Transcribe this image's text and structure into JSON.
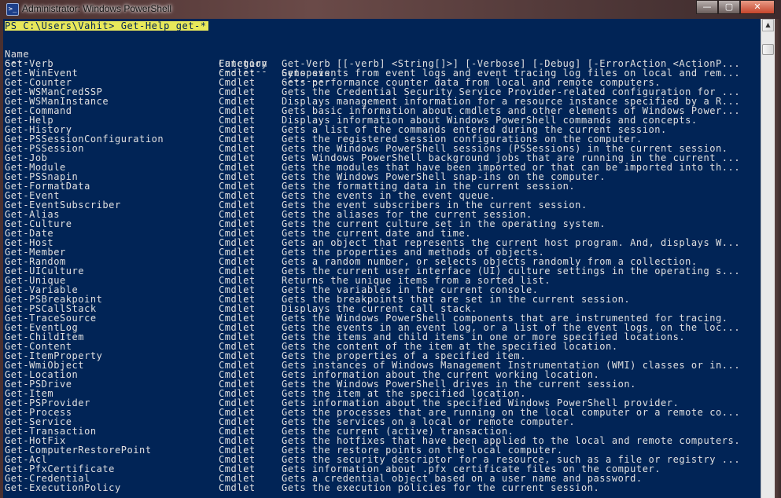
{
  "window": {
    "title": "Administrator: Windows PowerShell",
    "icon_label": ">_",
    "controls": {
      "minimize": "—",
      "maximize": "▢",
      "close": "✕"
    }
  },
  "console": {
    "prompt": "PS C:\\Users\\Vahit> Get-Help get-*",
    "headers": [
      "Name",
      "Category",
      "Synopsis"
    ],
    "underlines": [
      "----",
      "--------",
      "--------"
    ],
    "rows": [
      [
        "Get-Verb",
        "Function",
        "Get-Verb [[-verb] <String[]>] [-Verbose] [-Debug] [-ErrorAction <ActionP..."
      ],
      [
        "Get-WinEvent",
        "Cmdlet",
        "Gets events from event logs and event tracing log files on local and rem..."
      ],
      [
        "Get-Counter",
        "Cmdlet",
        "Gets performance counter data from local and remote computers."
      ],
      [
        "Get-WSManCredSSP",
        "Cmdlet",
        "Gets the Credential Security Service Provider-related configuration for ..."
      ],
      [
        "Get-WSManInstance",
        "Cmdlet",
        "Displays management information for a resource instance specified by a R..."
      ],
      [
        "Get-Command",
        "Cmdlet",
        "Gets basic information about cmdlets and other elements of Windows Power..."
      ],
      [
        "Get-Help",
        "Cmdlet",
        "Displays information about Windows PowerShell commands and concepts."
      ],
      [
        "Get-History",
        "Cmdlet",
        "Gets a list of the commands entered during the current session."
      ],
      [
        "Get-PSSessionConfiguration",
        "Cmdlet",
        "Gets the registered session configurations on the computer."
      ],
      [
        "Get-PSSession",
        "Cmdlet",
        "Gets the Windows PowerShell sessions (PSSessions) in the current session."
      ],
      [
        "Get-Job",
        "Cmdlet",
        "Gets Windows PowerShell background jobs that are running in the current ..."
      ],
      [
        "Get-Module",
        "Cmdlet",
        "Gets the modules that have been imported or that can be imported into th..."
      ],
      [
        "Get-PSSnapin",
        "Cmdlet",
        "Gets the Windows PowerShell snap-ins on the computer."
      ],
      [
        "Get-FormatData",
        "Cmdlet",
        "Gets the formatting data in the current session."
      ],
      [
        "Get-Event",
        "Cmdlet",
        "Gets the events in the event queue."
      ],
      [
        "Get-EventSubscriber",
        "Cmdlet",
        "Gets the event subscribers in the current session."
      ],
      [
        "Get-Alias",
        "Cmdlet",
        "Gets the aliases for the current session."
      ],
      [
        "Get-Culture",
        "Cmdlet",
        "Gets the current culture set in the operating system."
      ],
      [
        "Get-Date",
        "Cmdlet",
        "Gets the current date and time."
      ],
      [
        "Get-Host",
        "Cmdlet",
        "Gets an object that represents the current host program. And, displays W..."
      ],
      [
        "Get-Member",
        "Cmdlet",
        "Gets the properties and methods of objects."
      ],
      [
        "Get-Random",
        "Cmdlet",
        "Gets a random number, or selects objects randomly from a collection."
      ],
      [
        "Get-UICulture",
        "Cmdlet",
        "Gets the current user interface (UI) culture settings in the operating s..."
      ],
      [
        "Get-Unique",
        "Cmdlet",
        "Returns the unique items from a sorted list."
      ],
      [
        "Get-Variable",
        "Cmdlet",
        "Gets the variables in the current console."
      ],
      [
        "Get-PSBreakpoint",
        "Cmdlet",
        "Gets the breakpoints that are set in the current session."
      ],
      [
        "Get-PSCallStack",
        "Cmdlet",
        "Displays the current call stack."
      ],
      [
        "Get-TraceSource",
        "Cmdlet",
        "Gets the Windows PowerShell components that are instrumented for tracing."
      ],
      [
        "Get-EventLog",
        "Cmdlet",
        "Gets the events in an event log, or a list of the event logs, on the loc..."
      ],
      [
        "Get-ChildItem",
        "Cmdlet",
        "Gets the items and child items in one or more specified locations."
      ],
      [
        "Get-Content",
        "Cmdlet",
        "Gets the content of the item at the specified location."
      ],
      [
        "Get-ItemProperty",
        "Cmdlet",
        "Gets the properties of a specified item."
      ],
      [
        "Get-WmiObject",
        "Cmdlet",
        "Gets instances of Windows Management Instrumentation (WMI) classes or in..."
      ],
      [
        "Get-Location",
        "Cmdlet",
        "Gets information about the current working location."
      ],
      [
        "Get-PSDrive",
        "Cmdlet",
        "Gets the Windows PowerShell drives in the current session."
      ],
      [
        "Get-Item",
        "Cmdlet",
        "Gets the item at the specified location."
      ],
      [
        "Get-PSProvider",
        "Cmdlet",
        "Gets information about the specified Windows PowerShell provider."
      ],
      [
        "Get-Process",
        "Cmdlet",
        "Gets the processes that are running on the local computer or a remote co..."
      ],
      [
        "Get-Service",
        "Cmdlet",
        "Gets the services on a local or remote computer."
      ],
      [
        "Get-Transaction",
        "Cmdlet",
        "Gets the current (active) transaction."
      ],
      [
        "Get-HotFix",
        "Cmdlet",
        "Gets the hotfixes that have been applied to the local and remote computers."
      ],
      [
        "Get-ComputerRestorePoint",
        "Cmdlet",
        "Gets the restore points on the local computer."
      ],
      [
        "Get-Acl",
        "Cmdlet",
        "Gets the security descriptor for a resource, such as a file or registry ..."
      ],
      [
        "Get-PfxCertificate",
        "Cmdlet",
        "Gets information about .pfx certificate files on the computer."
      ],
      [
        "Get-Credential",
        "Cmdlet",
        "Gets a credential object based on a user name and password."
      ],
      [
        "Get-ExecutionPolicy",
        "Cmdlet",
        "Gets the execution policies for the current session."
      ]
    ]
  },
  "scrollbar": {
    "up_arrow": "▲"
  },
  "colors": {
    "console_bg": "#012456",
    "console_fg": "#e0e0e0",
    "prompt_highlight": "#e8e85a"
  }
}
